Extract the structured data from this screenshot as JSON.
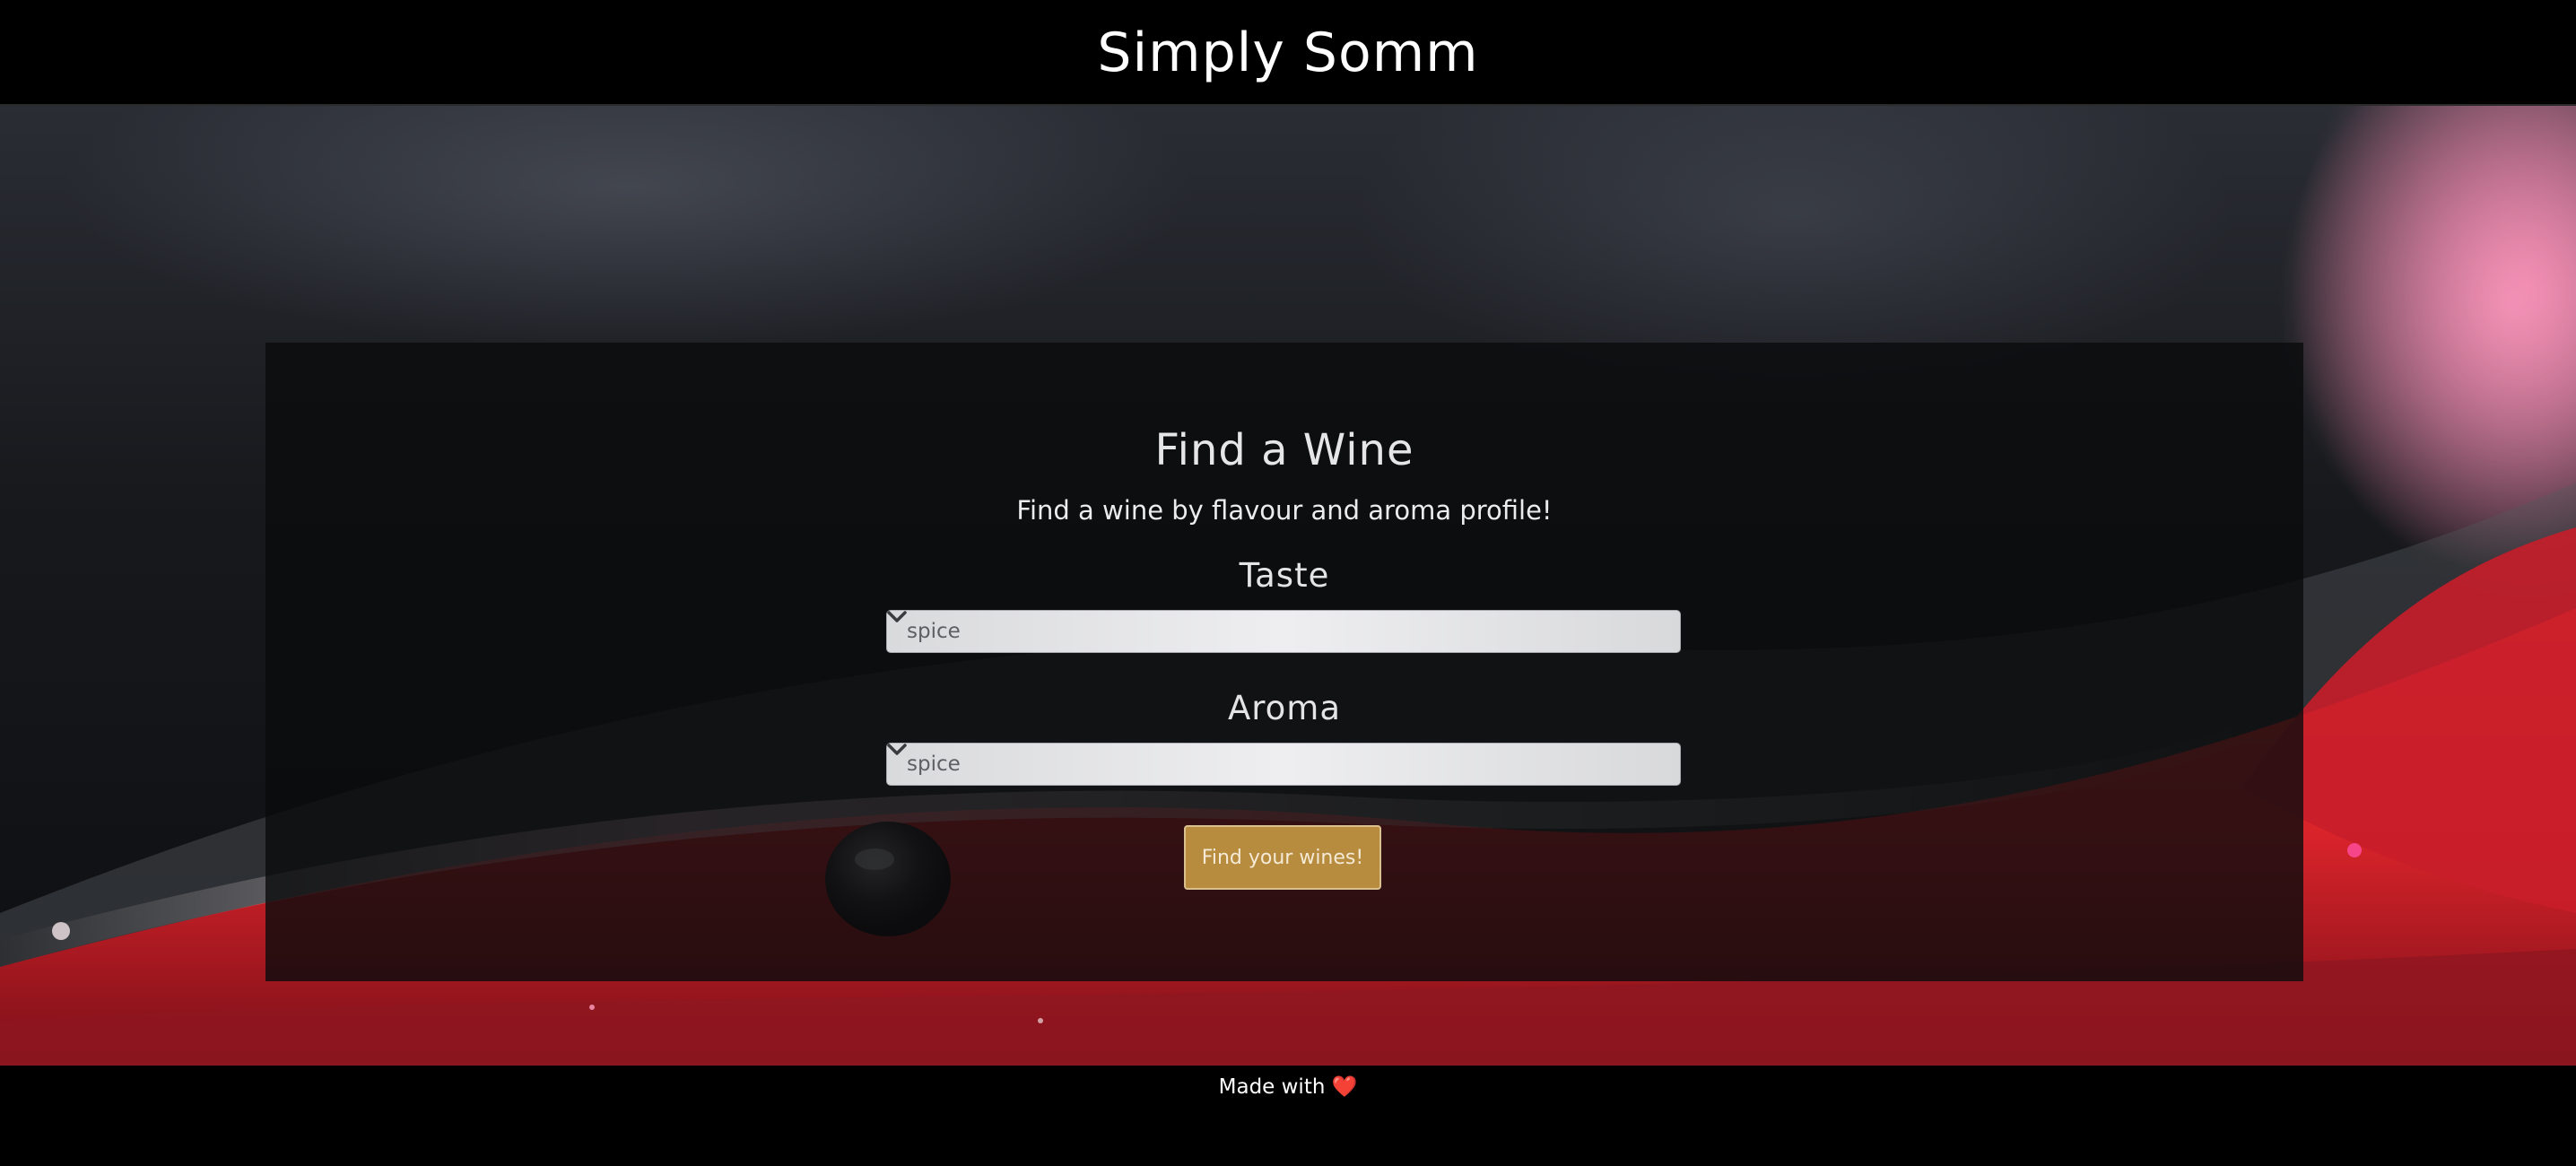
{
  "header": {
    "brand": "Simply Somm"
  },
  "main": {
    "title": "Find a Wine",
    "subtitle": "Find a wine by flavour and aroma profile!",
    "taste": {
      "label": "Taste",
      "selected": "spice"
    },
    "aroma": {
      "label": "Aroma",
      "selected": "spice"
    },
    "submit_label": "Find your wines!"
  },
  "footer": {
    "text": "Made with",
    "heart": "❤️"
  },
  "colors": {
    "header_bg": "#000000",
    "button_bg": "#b78c3f",
    "wine_red": "#e0262c"
  },
  "icons": {
    "select_chevron": "chevron-down-icon",
    "heart": "heart-icon"
  }
}
